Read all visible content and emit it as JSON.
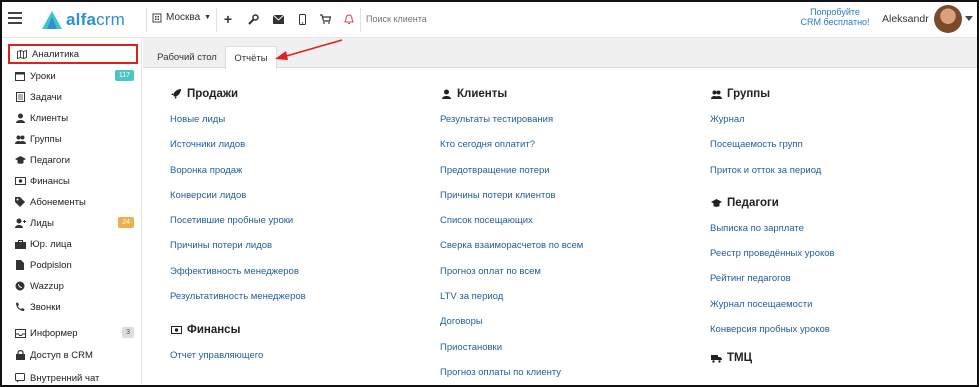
{
  "topbar": {
    "logo_text_a": "alfa",
    "logo_text_b": "crm",
    "city": "Москва",
    "search_placeholder": "Поиск клиента",
    "promo_line1": "Попробуйте",
    "promo_line2": "CRM бесплатно!",
    "username": "Aleksandr"
  },
  "sidebar": {
    "items": [
      {
        "label": "Аналитика",
        "icon": "map-icon"
      },
      {
        "label": "Уроки",
        "icon": "calendar-icon",
        "badge": "117"
      },
      {
        "label": "Задачи",
        "icon": "tasks-icon"
      },
      {
        "label": "Клиенты",
        "icon": "user-icon"
      },
      {
        "label": "Группы",
        "icon": "users-icon"
      },
      {
        "label": "Педагоги",
        "icon": "graduation-cap-icon"
      },
      {
        "label": "Финансы",
        "icon": "money-icon"
      },
      {
        "label": "Абонементы",
        "icon": "tag-icon"
      },
      {
        "label": "Лиды",
        "icon": "user-plus-icon",
        "badge": "24"
      },
      {
        "label": "Юр. лица",
        "icon": "briefcase-icon"
      },
      {
        "label": "Podpislon",
        "icon": "file-icon"
      },
      {
        "label": "Wazzup",
        "icon": "whatsapp-icon"
      },
      {
        "label": "Звонки",
        "icon": "phone-icon"
      },
      {
        "label": "Информер",
        "icon": "inbox-icon",
        "badge": "3"
      },
      {
        "label": "Доступ в CRM",
        "icon": "lock-icon"
      },
      {
        "label": "Внутренний чат",
        "icon": "chat-icon"
      }
    ]
  },
  "tabs": [
    {
      "label": "Рабочий стол"
    },
    {
      "label": "Отчёты"
    }
  ],
  "reports": {
    "sales": {
      "title": "Продажи",
      "links": [
        "Новые лиды",
        "Источники лидов",
        "Воронка продаж",
        "Конверсии лидов",
        "Посетившие пробные уроки",
        "Причины потери лидов",
        "Эффективность менеджеров",
        "Результативность менеджеров"
      ]
    },
    "finance": {
      "title": "Финансы",
      "links": [
        "Отчет управляющего"
      ]
    },
    "clients": {
      "title": "Клиенты",
      "links": [
        "Результаты тестирования",
        "Кто сегодня оплатит?",
        "Предотвращение потери",
        "Причины потери клиентов",
        "Список посещающих",
        "Сверка взаиморасчетов по всем",
        "Прогноз оплат по всем",
        "LTV за период",
        "Договоры",
        "Приостановки",
        "Прогноз оплаты по клиенту"
      ]
    },
    "groups": {
      "title": "Группы",
      "links": [
        "Журнал",
        "Посещаемость групп",
        "Приток и отток за период"
      ]
    },
    "teachers": {
      "title": "Педагоги",
      "links": [
        "Выписка по зарплате",
        "Реестр проведённых уроков",
        "Рейтинг педагогов",
        "Журнал посещаемости",
        "Конверсия пробных уроков"
      ]
    },
    "tmc": {
      "title": "ТМЦ"
    }
  },
  "colors": {
    "brand": "#2d8fd5",
    "link": "#1f5f99",
    "highlight": "#e02020"
  }
}
